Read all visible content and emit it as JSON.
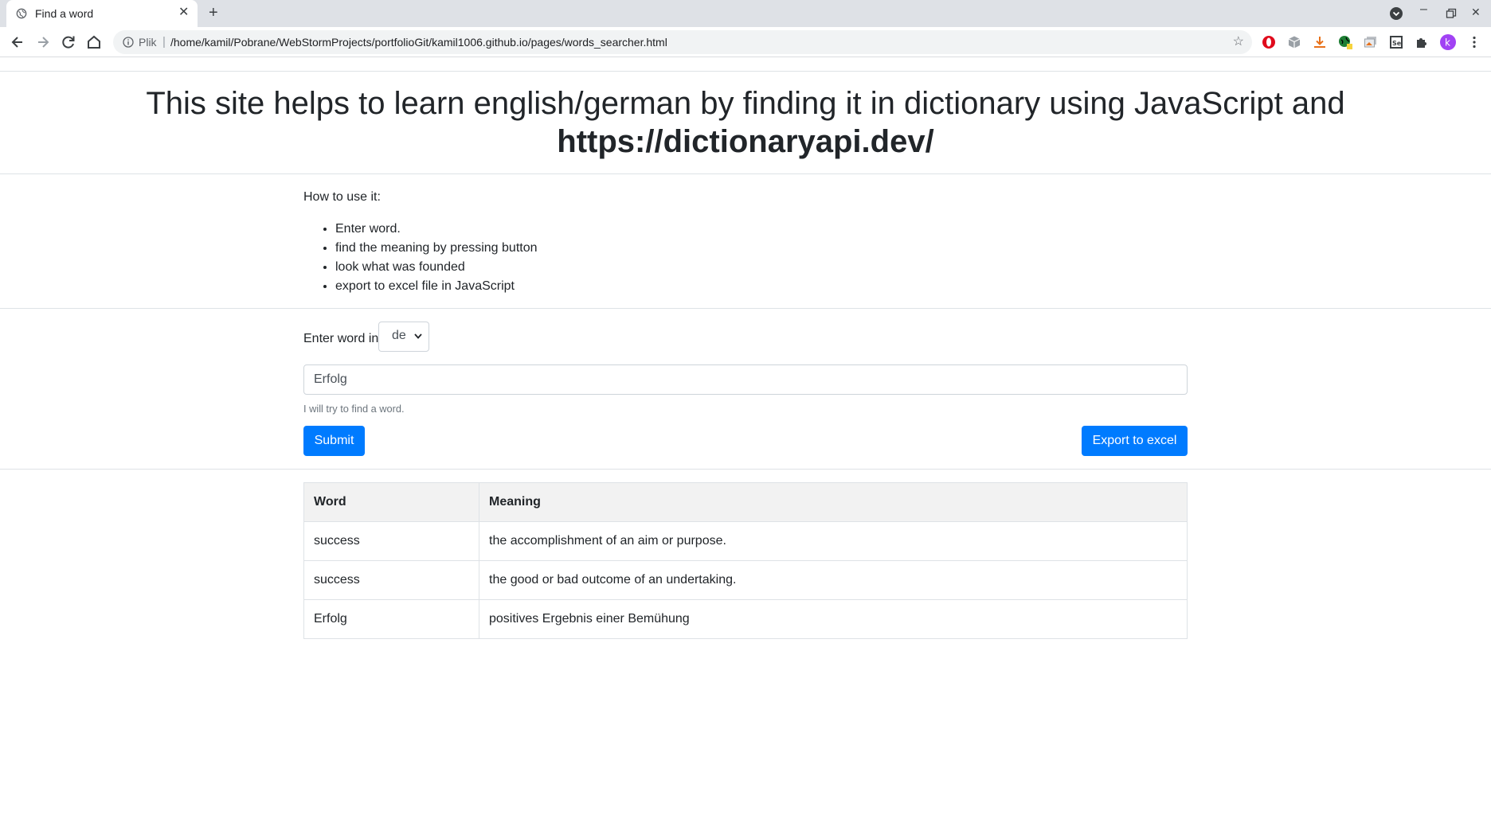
{
  "browser": {
    "tab_title": "Find a word",
    "omnibox_scheme_label": "Plik",
    "url": "/home/kamil/Pobrane/WebStormProjects/portfolioGit/kamil1006.github.io/pages/words_searcher.html",
    "profile_initial": "k"
  },
  "header": {
    "title_line1": "This site helps to learn english/german by finding it in dictionary using JavaScript and",
    "title_link": "https://dictionaryapi.dev/"
  },
  "instructions": {
    "heading": "How to use it:",
    "steps": [
      "Enter word.",
      "find the meaning by pressing button",
      "look what was founded",
      "export to excel file in JavaScript"
    ]
  },
  "form": {
    "enter_label": "Enter word in",
    "language_selected": "de",
    "word_value": "Erfolg",
    "help_text": "I will try to find a word.",
    "submit_label": "Submit",
    "export_label": "Export to excel"
  },
  "results": {
    "columns": [
      "Word",
      "Meaning"
    ],
    "rows": [
      {
        "word": "success",
        "meaning": "the accomplishment of an aim or purpose."
      },
      {
        "word": "success",
        "meaning": "the good or bad outcome of an undertaking."
      },
      {
        "word": "Erfolg",
        "meaning": "positives Ergebnis einer Bemühung"
      }
    ]
  },
  "colors": {
    "primary": "#007bff",
    "chrome_bg": "#dee1e6"
  }
}
